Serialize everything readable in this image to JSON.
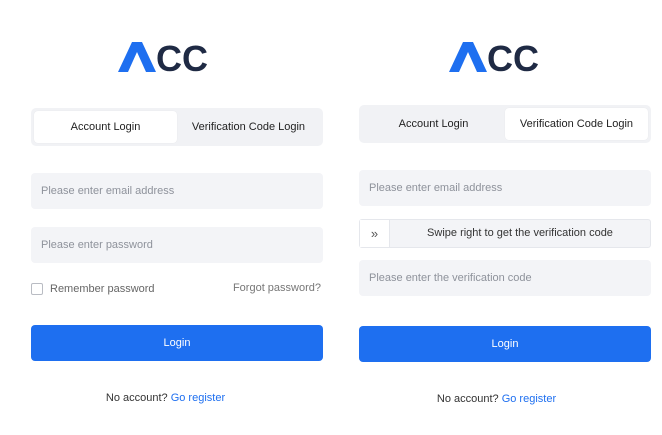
{
  "colors": {
    "brand": "#1e6ff0",
    "logo_dark": "#1f2a44",
    "field_bg": "#f3f4f7"
  },
  "left": {
    "logo_text": "CC",
    "tabs": {
      "account_login": "Account Login",
      "verification_login": "Verification Code Login",
      "active": "account_login"
    },
    "email_placeholder": "Please enter email address",
    "password_placeholder": "Please enter password",
    "remember_label": "Remember password",
    "forgot_label": "Forgot password?",
    "login_label": "Login",
    "no_account_text": "No account?",
    "register_link": "Go register"
  },
  "right": {
    "logo_text": "CC",
    "tabs": {
      "account_login": "Account Login",
      "verification_login": "Verification Code Login",
      "active": "verification_login"
    },
    "email_placeholder": "Please enter email address",
    "slider_icon": "»",
    "slider_text": "Swipe right to get the verification code",
    "code_placeholder": "Please enter the verification code",
    "login_label": "Login",
    "no_account_text": "No account?",
    "register_link": "Go register"
  }
}
